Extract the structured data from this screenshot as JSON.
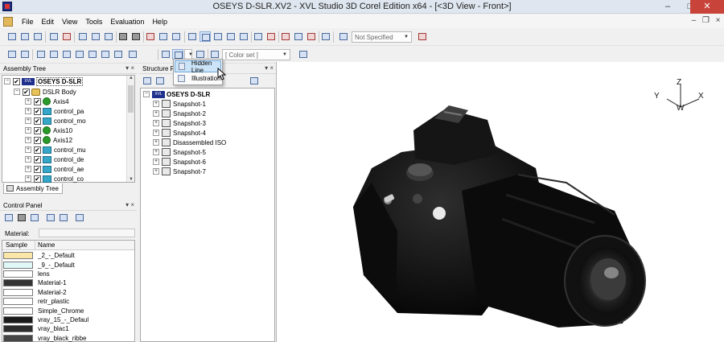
{
  "window": {
    "title": "OSEYS D-SLR.XV2 - XVL Studio 3D Corel Edition x64 - [<3D View - Front>]",
    "minimize": "–",
    "maximize": "□",
    "close": "✕"
  },
  "menu": {
    "items": [
      "File",
      "Edit",
      "View",
      "Tools",
      "Evaluation",
      "Help"
    ],
    "mdi_minimize": "–",
    "mdi_restore": "❐",
    "mdi_close": "×"
  },
  "toolbar": {
    "display_mode": "Not Specified",
    "color_set": "[ Color set ]"
  },
  "popup": {
    "items": [
      {
        "label": "Hidden Line"
      },
      {
        "label": "Illustration"
      }
    ]
  },
  "assembly_tree": {
    "title": "Assembly Tree",
    "root": "OSEYS D-SLR",
    "body": "DSLR Body",
    "items": [
      {
        "label": "Axis4",
        "kind": "axis"
      },
      {
        "label": "control_pa",
        "kind": "ctrl"
      },
      {
        "label": "control_mo",
        "kind": "ctrl"
      },
      {
        "label": "Axis10",
        "kind": "axis"
      },
      {
        "label": "Axis12",
        "kind": "axis"
      },
      {
        "label": "control_mu",
        "kind": "ctrl"
      },
      {
        "label": "control_de",
        "kind": "ctrl"
      },
      {
        "label": "control_ae",
        "kind": "ctrl"
      },
      {
        "label": "control_co",
        "kind": "ctrl"
      }
    ],
    "tab_label": "Assembly Tree"
  },
  "structure_panel": {
    "title": "Structure P",
    "root": "OSEYS D-SLR",
    "items": [
      "Snapshot-1",
      "Snapshot-2",
      "Snapshot-3",
      "Snapshot-4",
      "Disassembled ISO",
      "Snapshot-5",
      "Snapshot-6",
      "Snapshot-7"
    ]
  },
  "control_panel": {
    "title": "Control Panel",
    "material_label": "Material:",
    "columns": {
      "sample": "Sample",
      "name": "Name"
    },
    "materials": [
      {
        "name": "_2_-_Default",
        "color": "#fbe6a9"
      },
      {
        "name": "_9_-_Default",
        "color": "#e0f7f8"
      },
      {
        "name": "lens",
        "color": "#ffffff"
      },
      {
        "name": "Material-1",
        "color": "#333333"
      },
      {
        "name": "Material-2",
        "color": "#ffffff"
      },
      {
        "name": "retr_plastic",
        "color": "#ffffff"
      },
      {
        "name": "Simple_Chrome",
        "color": "#ffffff"
      },
      {
        "name": "vray_15_-_Defaul",
        "color": "#1a1a1a"
      },
      {
        "name": "vray_blac1",
        "color": "#2c2c2c"
      },
      {
        "name": "vray_black_ribbe",
        "color": "#454545"
      }
    ]
  },
  "view": {
    "axis_labels": {
      "z": "Z",
      "y": "Y",
      "x": "X",
      "w": "W"
    }
  }
}
